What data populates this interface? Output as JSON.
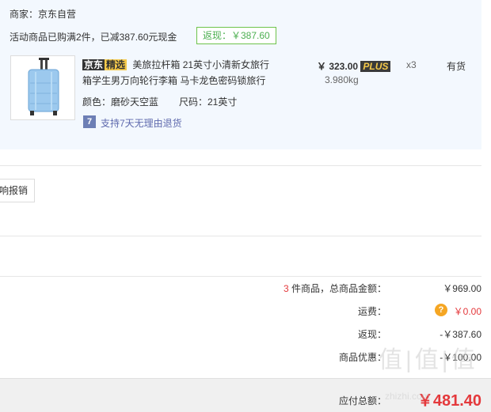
{
  "order": {
    "merchant": "商家：京东自营",
    "promo": "活动商品已购满2件，已减387.60元现金",
    "cashback_tag": "返现：￥387.60",
    "item": {
      "badge_jd": "京东",
      "badge_select": "精选",
      "title_line1": "美旅拉杆箱 21英寸小清新女旅行",
      "title_line2": "箱学生男万向轮行李箱 马卡龙色密码锁旅行",
      "color": "颜色：磨砂天空蓝",
      "size": "尺码：21英寸",
      "return_icon": "7",
      "return_policy": "支持7天无理由退货",
      "price": "￥ 323.00",
      "plus": "PLUS",
      "weight": "3.980kg",
      "qty": "x3",
      "stock": "有货"
    }
  },
  "invoice": {
    "button_fragment": "响报销"
  },
  "summary": {
    "count": "3",
    "count_label": "件商品，总商品金额：",
    "goods_total": "￥969.00",
    "shipping_label": "运费：",
    "shipping_help": "?",
    "shipping_value": "￥0.00",
    "cashback_label": "返现：",
    "cashback_value": "-￥387.60",
    "discount_label": "商品优惠：",
    "discount_value": "-￥100.00",
    "payable_label": "应付总额：",
    "payable_value": "￥481.40"
  },
  "watermark": {
    "text": "值|值|值",
    "subtext": "zhizhi.com"
  },
  "colors": {
    "panel_bg": "#f3f8fe",
    "accent_red": "#e4393c",
    "cashback_green": "#4caf50",
    "help_orange": "#f5a623"
  },
  "icons": {
    "return": "return-icon",
    "help": "help-icon",
    "suitcase": "suitcase-icon"
  }
}
